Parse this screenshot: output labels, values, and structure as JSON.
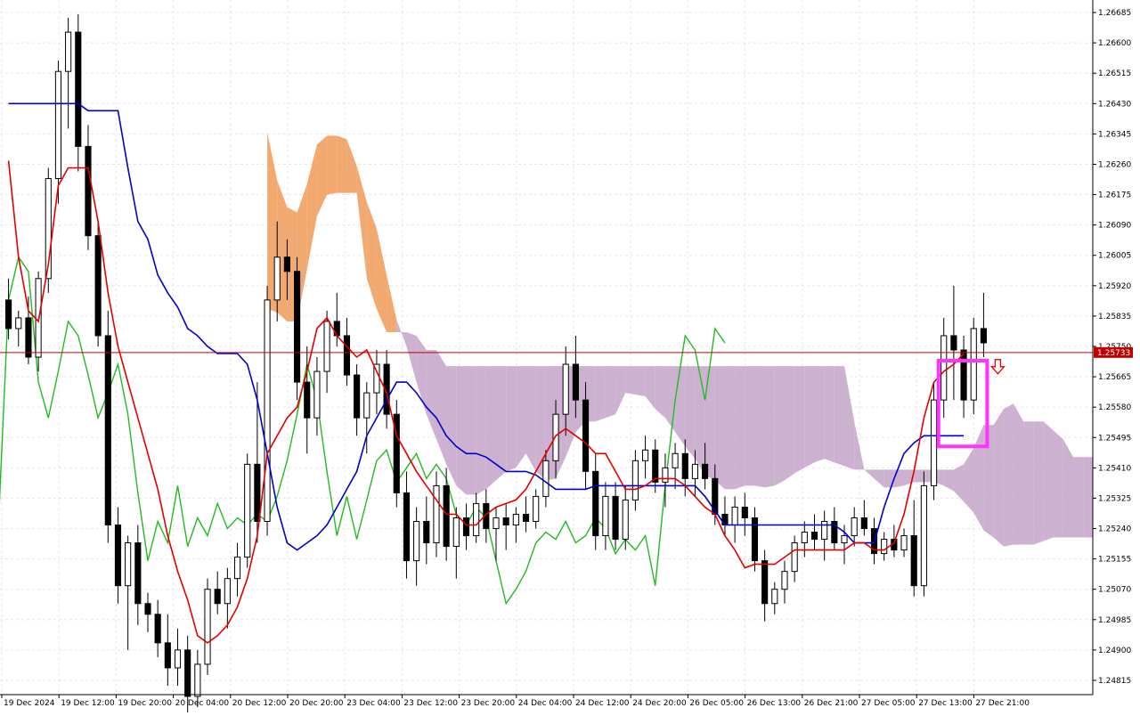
{
  "chart_data": {
    "type": "candlestick",
    "indicator": "Ichimoku Kinko Hyo",
    "y_ticks": [
      "1.26685",
      "1.26600",
      "1.26515",
      "1.26430",
      "1.26345",
      "1.26260",
      "1.26175",
      "1.26090",
      "1.26005",
      "1.25920",
      "1.25835",
      "1.25750",
      "1.25665",
      "1.25580",
      "1.25495",
      "1.25410",
      "1.25325",
      "1.25240",
      "1.25155",
      "1.25070",
      "1.24985",
      "1.24900",
      "1.24815"
    ],
    "x_ticks": [
      "19 Dec 2024",
      "19 Dec 12:00",
      "19 Dec 20:00",
      "20 Dec 04:00",
      "20 Dec 12:00",
      "20 Dec 20:00",
      "23 Dec 04:00",
      "23 Dec 12:00",
      "23 Dec 20:00",
      "24 Dec 04:00",
      "24 Dec 12:00",
      "24 Dec 20:00",
      "26 Dec 05:00",
      "26 Dec 13:00",
      "26 Dec 21:00",
      "27 Dec 05:00",
      "27 Dec 13:00",
      "27 Dec 21:00"
    ],
    "ylim": [
      1.24775,
      1.2672
    ],
    "current_price": "1.25733",
    "grid": true,
    "colors": {
      "bull_candle": "#ffffff",
      "bear_candle": "#000000",
      "tenkan_sen": "#e00000",
      "kijun_sen": "#0000cc",
      "chikou_span": "#22bb22",
      "kumo_bearish": "#c8a8cc",
      "kumo_bullish": "#f0a060",
      "price_line": "#c00000",
      "highlight_box": "#ff33ff",
      "sell_arrow": "#e00000"
    },
    "candles": [
      [
        1.2588,
        1.2594,
        1.2577,
        1.258
      ],
      [
        1.258,
        1.2585,
        1.2575,
        1.2583
      ],
      [
        1.2583,
        1.2589,
        1.257,
        1.2572
      ],
      [
        1.2572,
        1.2596,
        1.2568,
        1.2594
      ],
      [
        1.2594,
        1.2625,
        1.259,
        1.2622
      ],
      [
        1.2622,
        1.2655,
        1.2615,
        1.2652
      ],
      [
        1.2652,
        1.2667,
        1.2636,
        1.2663
      ],
      [
        1.2663,
        1.2668,
        1.2624,
        1.2631
      ],
      [
        1.2631,
        1.2637,
        1.2602,
        1.2606
      ],
      [
        1.2606,
        1.261,
        1.2575,
        1.2578
      ],
      [
        1.2578,
        1.2585,
        1.252,
        1.2525
      ],
      [
        1.2525,
        1.253,
        1.2503,
        1.2508
      ],
      [
        1.2508,
        1.2522,
        1.249,
        1.252
      ],
      [
        1.252,
        1.2525,
        1.2497,
        1.2503
      ],
      [
        1.2503,
        1.2506,
        1.2495,
        1.25
      ],
      [
        1.25,
        1.2504,
        1.2488,
        1.2492
      ],
      [
        1.2492,
        1.25,
        1.248,
        1.2485
      ],
      [
        1.2485,
        1.2496,
        1.248,
        1.249
      ],
      [
        1.249,
        1.2494,
        1.2471,
        1.2477
      ],
      [
        1.2477,
        1.249,
        1.2474,
        1.2486
      ],
      [
        1.2486,
        1.251,
        1.2483,
        1.2507
      ],
      [
        1.2507,
        1.2512,
        1.25,
        1.2503
      ],
      [
        1.2503,
        1.2513,
        1.2496,
        1.251
      ],
      [
        1.251,
        1.252,
        1.2505,
        1.2516
      ],
      [
        1.2516,
        1.2545,
        1.2513,
        1.2542
      ],
      [
        1.2542,
        1.2565,
        1.252,
        1.2526
      ],
      [
        1.2526,
        1.2592,
        1.2522,
        1.2588
      ],
      [
        1.2588,
        1.261,
        1.2582,
        1.26
      ],
      [
        1.26,
        1.2605,
        1.2588,
        1.2596
      ],
      [
        1.2596,
        1.26,
        1.256,
        1.2565
      ],
      [
        1.2565,
        1.2575,
        1.2545,
        1.2555
      ],
      [
        1.2555,
        1.2572,
        1.255,
        1.2568
      ],
      [
        1.2568,
        1.2585,
        1.2562,
        1.2582
      ],
      [
        1.2582,
        1.259,
        1.2575,
        1.2578
      ],
      [
        1.2578,
        1.2583,
        1.2564,
        1.2567
      ],
      [
        1.2567,
        1.257,
        1.255,
        1.2555
      ],
      [
        1.2555,
        1.2565,
        1.2545,
        1.2562
      ],
      [
        1.2562,
        1.2574,
        1.2556,
        1.257
      ],
      [
        1.257,
        1.2574,
        1.2552,
        1.2556
      ],
      [
        1.2556,
        1.256,
        1.253,
        1.2534
      ],
      [
        1.2534,
        1.254,
        1.251,
        1.2515
      ],
      [
        1.2515,
        1.253,
        1.2508,
        1.2526
      ],
      [
        1.2526,
        1.2533,
        1.2514,
        1.252
      ],
      [
        1.252,
        1.254,
        1.2516,
        1.2536
      ],
      [
        1.2536,
        1.2541,
        1.2515,
        1.2519
      ],
      [
        1.2519,
        1.253,
        1.251,
        1.2527
      ],
      [
        1.2527,
        1.2531,
        1.2518,
        1.2522
      ],
      [
        1.2522,
        1.2534,
        1.252,
        1.2531
      ],
      [
        1.2531,
        1.2535,
        1.252,
        1.2524
      ],
      [
        1.2524,
        1.253,
        1.2515,
        1.2527
      ],
      [
        1.2527,
        1.2531,
        1.2518,
        1.2525
      ],
      [
        1.2525,
        1.253,
        1.252,
        1.2528
      ],
      [
        1.2528,
        1.2533,
        1.2523,
        1.2526
      ],
      [
        1.2526,
        1.2535,
        1.2524,
        1.2533
      ],
      [
        1.2533,
        1.2546,
        1.253,
        1.2543
      ],
      [
        1.2543,
        1.256,
        1.2538,
        1.2556
      ],
      [
        1.2556,
        1.2575,
        1.255,
        1.257
      ],
      [
        1.257,
        1.2578,
        1.2555,
        1.256
      ],
      [
        1.256,
        1.2565,
        1.2535,
        1.254
      ],
      [
        1.254,
        1.2545,
        1.2518,
        1.2522
      ],
      [
        1.2522,
        1.2537,
        1.2518,
        1.2533
      ],
      [
        1.2533,
        1.2537,
        1.2518,
        1.2521
      ],
      [
        1.2521,
        1.2536,
        1.2518,
        1.2532
      ],
      [
        1.2532,
        1.2546,
        1.2529,
        1.2543
      ],
      [
        1.2543,
        1.255,
        1.2538,
        1.2546
      ],
      [
        1.2546,
        1.2549,
        1.2534,
        1.2537
      ],
      [
        1.2537,
        1.2545,
        1.253,
        1.2541
      ],
      [
        1.2541,
        1.2548,
        1.2535,
        1.2545
      ],
      [
        1.2545,
        1.2549,
        1.2533,
        1.2538
      ],
      [
        1.2538,
        1.2546,
        1.2533,
        1.2542
      ],
      [
        1.2542,
        1.2548,
        1.2535,
        1.2538
      ],
      [
        1.2538,
        1.2542,
        1.2525,
        1.2528
      ],
      [
        1.2528,
        1.2533,
        1.2522,
        1.2525
      ],
      [
        1.2525,
        1.2533,
        1.252,
        1.253
      ],
      [
        1.253,
        1.2534,
        1.2522,
        1.2527
      ],
      [
        1.2527,
        1.253,
        1.2512,
        1.2515
      ],
      [
        1.2515,
        1.2518,
        1.2498,
        1.2503
      ],
      [
        1.2503,
        1.2509,
        1.25,
        1.2507
      ],
      [
        1.2507,
        1.2515,
        1.2503,
        1.2512
      ],
      [
        1.2512,
        1.2522,
        1.2509,
        1.252
      ],
      [
        1.252,
        1.2526,
        1.2516,
        1.2523
      ],
      [
        1.2523,
        1.2528,
        1.2518,
        1.2521
      ],
      [
        1.2521,
        1.2529,
        1.2515,
        1.2526
      ],
      [
        1.2526,
        1.253,
        1.2518,
        1.252
      ],
      [
        1.252,
        1.2525,
        1.2514,
        1.2522
      ],
      [
        1.2522,
        1.253,
        1.2519,
        1.2527
      ],
      [
        1.2527,
        1.2532,
        1.2522,
        1.2524
      ],
      [
        1.2524,
        1.2527,
        1.2514,
        1.2517
      ],
      [
        1.2517,
        1.2523,
        1.2515,
        1.2521
      ],
      [
        1.2521,
        1.2525,
        1.2516,
        1.2518
      ],
      [
        1.2518,
        1.2524,
        1.2516,
        1.2522
      ],
      [
        1.2522,
        1.2532,
        1.2505,
        1.2508
      ],
      [
        1.2508,
        1.254,
        1.2505,
        1.2536
      ],
      [
        1.2536,
        1.2565,
        1.2532,
        1.256
      ],
      [
        1.256,
        1.2583,
        1.2555,
        1.2578
      ],
      [
        1.2578,
        1.2592,
        1.256,
        1.2574
      ],
      [
        1.2574,
        1.2578,
        1.2555,
        1.256
      ],
      [
        1.256,
        1.2583,
        1.2556,
        1.258
      ],
      [
        1.258,
        1.259,
        1.2572,
        1.2576
      ]
    ],
    "tenkan_sen": [
      1.2627,
      1.26,
      1.2585,
      1.2582,
      1.2598,
      1.262,
      1.2625,
      1.2625,
      1.2625,
      1.261,
      1.259,
      1.2575,
      1.2565,
      1.2555,
      1.2545,
      1.2535,
      1.2522,
      1.2512,
      1.2504,
      1.2494,
      1.2492,
      1.2494,
      1.2497,
      1.2502,
      1.251,
      1.2522,
      1.2545,
      1.255,
      1.2555,
      1.2558,
      1.2568,
      1.258,
      1.2583,
      1.2578,
      1.2575,
      1.2572,
      1.2574,
      1.2568,
      1.2562,
      1.255,
      1.2545,
      1.254,
      1.2536,
      1.2532,
      1.2528,
      1.2528,
      1.2525,
      1.2525,
      1.2528,
      1.253,
      1.2531,
      1.2532,
      1.2535,
      1.254,
      1.2545,
      1.255,
      1.2552,
      1.255,
      1.2548,
      1.2545,
      1.2545,
      1.254,
      1.2535,
      1.2535,
      1.2536,
      1.2538,
      1.2538,
      1.2538,
      1.2536,
      1.2533,
      1.253,
      1.2528,
      1.2522,
      1.2518,
      1.2513,
      1.2514,
      1.2514,
      1.2514,
      1.2516,
      1.2518,
      1.2518,
      1.2518,
      1.2518,
      1.2518,
      1.2518,
      1.252,
      1.252,
      1.2518,
      1.2518,
      1.252,
      1.2528,
      1.254,
      1.2555,
      1.2565,
      1.2568,
      1.257,
      1.2573
    ],
    "kijun_sen": [
      1.2643,
      1.2643,
      1.2643,
      1.2643,
      1.2643,
      1.2643,
      1.2643,
      1.2643,
      1.2641,
      1.2641,
      1.2641,
      1.2641,
      1.2625,
      1.261,
      1.2605,
      1.2595,
      1.259,
      1.2586,
      1.258,
      1.2578,
      1.2575,
      1.2573,
      1.2573,
      1.2573,
      1.257,
      1.256,
      1.2545,
      1.253,
      1.252,
      1.2518,
      1.252,
      1.2522,
      1.2525,
      1.253,
      1.2535,
      1.254,
      1.255,
      1.2555,
      1.256,
      1.2565,
      1.2565,
      1.2562,
      1.2558,
      1.2555,
      1.255,
      1.2547,
      1.2545,
      1.2545,
      1.2544,
      1.2542,
      1.254,
      1.254,
      1.254,
      1.2539,
      1.2537,
      1.2535,
      1.2535,
      1.2535,
      1.2535,
      1.2536,
      1.2536,
      1.2536,
      1.2536,
      1.2536,
      1.2536,
      1.2536,
      1.2536,
      1.2536,
      1.2536,
      1.2536,
      1.2533,
      1.2529,
      1.2525,
      1.2525,
      1.2525,
      1.2525,
      1.2525,
      1.2525,
      1.2525,
      1.2525,
      1.2525,
      1.2525,
      1.2525,
      1.2525,
      1.2523,
      1.252,
      1.252,
      1.252,
      1.253,
      1.2538,
      1.2545,
      1.2548,
      1.255,
      1.255,
      1.255,
      1.255,
      1.255
    ]
  },
  "annotations": {
    "highlight_box": true,
    "sell_arrow": true
  }
}
